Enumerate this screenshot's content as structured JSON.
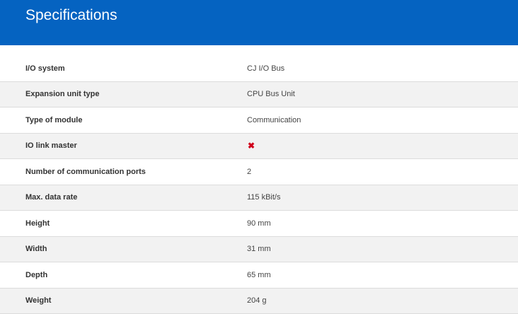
{
  "header": {
    "title": "Specifications"
  },
  "specs": [
    {
      "label": "I/O system",
      "value": "CJ I/O Bus"
    },
    {
      "label": "Expansion unit type",
      "value": "CPU Bus Unit"
    },
    {
      "label": "Type of module",
      "value": "Communication"
    },
    {
      "label": "IO link master",
      "value": "",
      "icon": "x-icon",
      "icon_color": "#d0021b"
    },
    {
      "label": "Number of communication ports",
      "value": "2"
    },
    {
      "label": "Max. data rate",
      "value": "115 kBit/s"
    },
    {
      "label": "Height",
      "value": "90 mm"
    },
    {
      "label": "Width",
      "value": "31 mm"
    },
    {
      "label": "Depth",
      "value": "65 mm"
    },
    {
      "label": "Weight",
      "value": "204 g"
    }
  ],
  "colors": {
    "header_bg": "#0563c1",
    "stripe_bg": "#f2f2f2",
    "divider": "#dcdcdc"
  }
}
